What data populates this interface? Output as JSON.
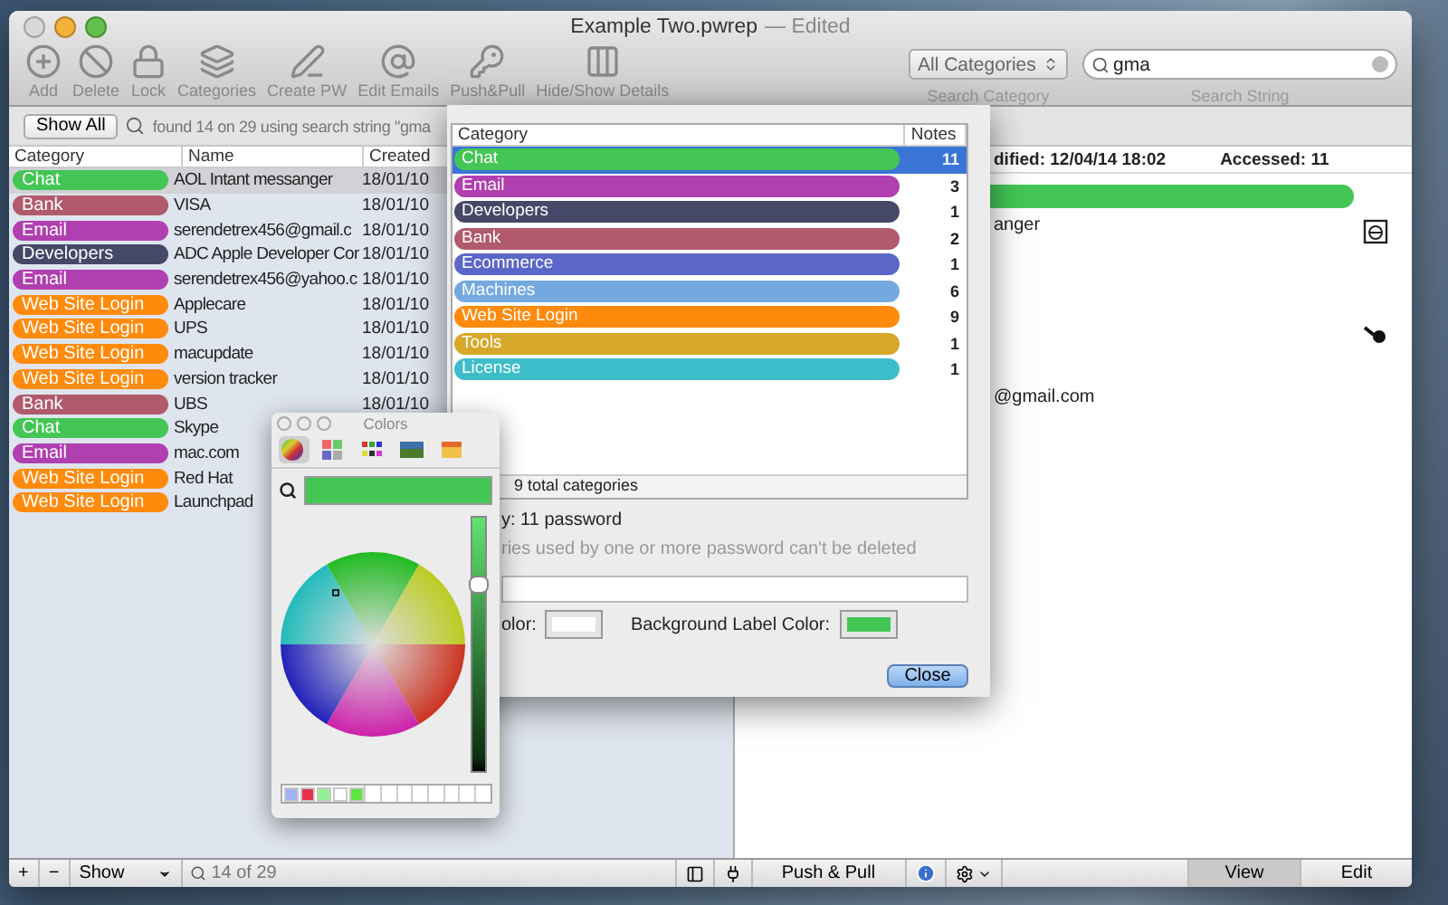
{
  "window": {
    "title": "Example Two.pwrep",
    "edited": "— Edited"
  },
  "toolbar": {
    "buttons": [
      {
        "label": "Add",
        "kind": "add"
      },
      {
        "label": "Delete",
        "kind": "delete"
      },
      {
        "label": "Lock",
        "kind": "lock"
      },
      {
        "label": "Categories",
        "kind": "categories"
      },
      {
        "label": "Create PW",
        "kind": "create"
      },
      {
        "label": "Edit Emails",
        "kind": "email"
      },
      {
        "label": "Push&Pull",
        "kind": "push"
      },
      {
        "label": "Hide/Show Details",
        "kind": "details"
      }
    ],
    "category_select": {
      "value": "All Categories",
      "caption": "Search Category"
    },
    "search": {
      "value": "gma",
      "caption": "Search String"
    }
  },
  "list_pane": {
    "show_all": "Show All",
    "status": "found 14 on 29 using search string \"gma",
    "columns": [
      "Category",
      "Name",
      "Created"
    ],
    "rows": [
      {
        "category": "Chat",
        "color": "#44c655",
        "name": "AOL Intant messanger",
        "created": "18/01/10",
        "selected": true
      },
      {
        "category": "Bank",
        "color": "#b05a6c",
        "name": "VISA",
        "created": "18/01/10",
        "selected": false
      },
      {
        "category": "Email",
        "color": "#b03fb0",
        "name": "serendetrex456@gmail.c",
        "created": "18/01/10",
        "selected": false
      },
      {
        "category": "Developers",
        "color": "#454867",
        "name": "ADC Apple Developer Cor",
        "created": "18/01/10",
        "selected": false
      },
      {
        "category": "Email",
        "color": "#b03fb0",
        "name": "serendetrex456@yahoo.c",
        "created": "18/01/10",
        "selected": false
      },
      {
        "category": "Web Site Login",
        "color": "#ff8a0c",
        "name": "Applecare",
        "created": "18/01/10",
        "selected": false
      },
      {
        "category": "Web Site Login",
        "color": "#ff8a0c",
        "name": "UPS",
        "created": "18/01/10",
        "selected": false
      },
      {
        "category": "Web Site Login",
        "color": "#ff8a0c",
        "name": "macupdate",
        "created": "18/01/10",
        "selected": false
      },
      {
        "category": "Web Site Login",
        "color": "#ff8a0c",
        "name": "version tracker",
        "created": "18/01/10",
        "selected": false
      },
      {
        "category": "Bank",
        "color": "#b05a6c",
        "name": "UBS",
        "created": "18/01/10",
        "selected": false
      },
      {
        "category": "Chat",
        "color": "#44c655",
        "name": "Skype",
        "selected": false
      },
      {
        "category": "Email",
        "color": "#b03fb0",
        "name": "mac.com",
        "selected": false
      },
      {
        "category": "Web Site Login",
        "color": "#ff8a0c",
        "name": "Red Hat",
        "selected": false
      },
      {
        "category": "Web Site Login",
        "color": "#ff8a0c",
        "name": "Launchpad",
        "selected": false
      }
    ]
  },
  "detail": {
    "modified": "dified:  12/04/14 18:02",
    "accessed": "Accessed:  11",
    "name_tail": "anger",
    "email_tail": "@gmail.com"
  },
  "bottom_bar": {
    "add": "+",
    "remove": "−",
    "show": "Show",
    "count": "14 of 29",
    "push_pull": "Push & Pull",
    "tabs": [
      {
        "label": "View",
        "selected": true
      },
      {
        "label": "Edit",
        "selected": false
      }
    ]
  },
  "category_sheet": {
    "columns": [
      "Category",
      "Notes"
    ],
    "rows": [
      {
        "name": "Chat",
        "color": "#44c655",
        "notes": "11",
        "selected": true
      },
      {
        "name": "Email",
        "color": "#b03fb0",
        "notes": "3",
        "selected": false
      },
      {
        "name": "Developers",
        "color": "#454867",
        "notes": "1",
        "selected": false
      },
      {
        "name": "Bank",
        "color": "#b05a6c",
        "notes": "2",
        "selected": false
      },
      {
        "name": "Ecommerce",
        "color": "#5a66c8",
        "notes": "1",
        "selected": false
      },
      {
        "name": "Machines",
        "color": "#74a9e0",
        "notes": "6",
        "selected": false
      },
      {
        "name": "Web Site Login",
        "color": "#ff8a0c",
        "notes": "9",
        "selected": false
      },
      {
        "name": "Tools",
        "color": "#d6a82a",
        "notes": "1",
        "selected": false
      },
      {
        "name": "License",
        "color": "#3dbdc9",
        "notes": "1",
        "selected": false
      }
    ],
    "total": "9 total categories",
    "usage": "y:  11 password",
    "hint": "ries used by one or more  password can't be deleted",
    "text_color_label": "olor:",
    "background_label": "Background Label Color:",
    "close": "Close"
  },
  "colors_panel": {
    "title": "Colors",
    "modes": [
      {
        "kind": "wheel",
        "selected": true
      },
      {
        "kind": "sliders",
        "selected": false
      },
      {
        "kind": "palette",
        "selected": false
      },
      {
        "kind": "image",
        "selected": false
      },
      {
        "kind": "crayons",
        "selected": false
      }
    ],
    "level": 0.76,
    "swatches": [
      {
        "color": "#a3b0f2"
      },
      {
        "color": "#e8304e"
      },
      {
        "color": "#93ef93"
      },
      {
        "color": "#ffffff"
      },
      {
        "color": "#5fe440"
      }
    ]
  }
}
